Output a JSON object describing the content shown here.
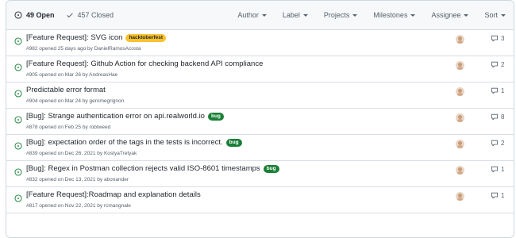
{
  "header": {
    "open_label": "49 Open",
    "closed_label": "457 Closed",
    "filters": [
      "Author",
      "Label",
      "Projects",
      "Milestones",
      "Assignee",
      "Sort"
    ]
  },
  "issues": [
    {
      "title": "[Feature Request]: SVG icon",
      "labels": [
        {
          "text": "hacktoberfest",
          "color": "yellow"
        }
      ],
      "meta": "#982 opened 25 days ago by DanielRamosAcosta",
      "comments": "3"
    },
    {
      "title": "[Feature Request]: Github Action for checking backend API compliance",
      "labels": [],
      "meta": "#905 opened on Mar 26 by AndreasHae",
      "comments": "2"
    },
    {
      "title": "Predictable error format",
      "labels": [],
      "meta": "#904 opened on Mar 24 by geromegrignon",
      "comments": "1"
    },
    {
      "title": "[Bug]: Strange authentication error on api.realworld.io",
      "labels": [
        {
          "text": "bug",
          "color": "green"
        }
      ],
      "meta": "#878 opened on Feb 25 by robtweed",
      "comments": "8"
    },
    {
      "title": "[Bug]: expectation order of the tags in the tests is incorrect.",
      "labels": [
        {
          "text": "bug",
          "color": "green"
        }
      ],
      "meta": "#839 opened on Dec 26, 2021 by KostyaTretyak",
      "comments": "2"
    },
    {
      "title": "[Bug]: Regex in Postman collection rejects valid ISO-8601 timestamps",
      "labels": [
        {
          "text": "bug",
          "color": "green"
        }
      ],
      "meta": "#832 opened on Dec 13, 2021 by abonander",
      "comments": "1"
    },
    {
      "title": "[Feature Request]:Roadmap and explanation details",
      "labels": [],
      "meta": "#817 opened on Nov 22, 2021 by rcmangnale",
      "comments": "1"
    }
  ],
  "colors": {
    "open_icon": "#1a7f37",
    "label_yellow": "#f9c22e",
    "label_green": "#1a7f37"
  }
}
